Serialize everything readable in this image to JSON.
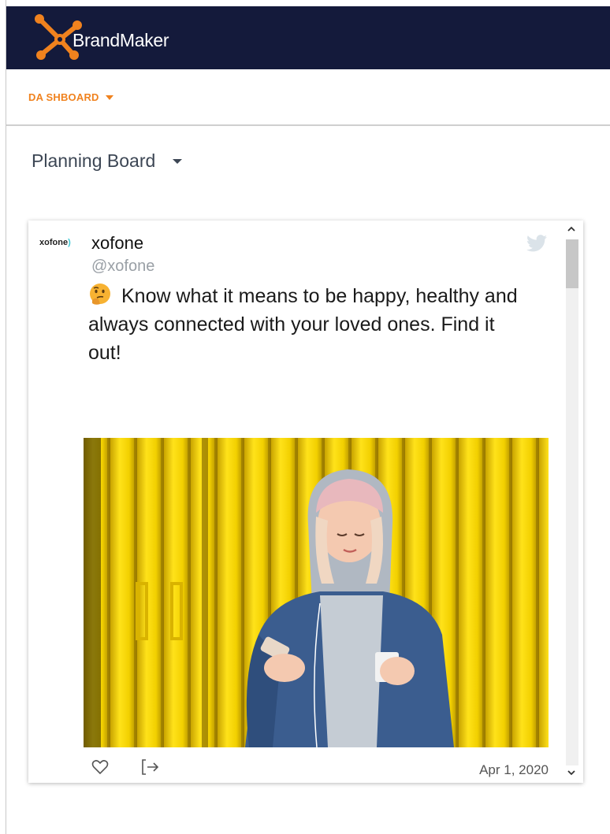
{
  "header": {
    "brand_name": "BrandMaker",
    "logo_icon": "brandmaker-x-logo",
    "background_color": "#141a3b",
    "accent_color": "#f0821e"
  },
  "nav": {
    "dashboard_label": "DA SHBOARD"
  },
  "board": {
    "selected": "Planning Board"
  },
  "post": {
    "account_logo_text": "xofone",
    "account_logo_paren": ")",
    "account_name": "xofone",
    "account_handle": "@xofone",
    "emoji": "thinking-face",
    "text": "Know what it means to be happy, healthy and always connected with your loved ones. Find it out!",
    "platform_icon": "twitter-bird-icon",
    "date": "Apr 1, 2020",
    "actions": [
      "like-icon",
      "share-icon"
    ]
  }
}
